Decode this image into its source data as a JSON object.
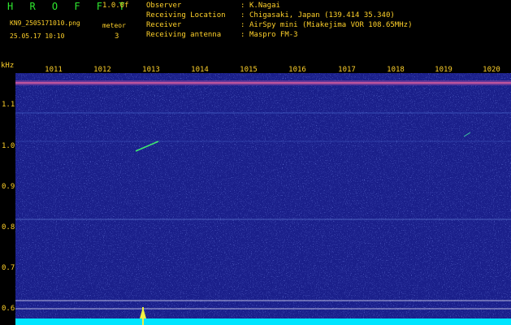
{
  "header": {
    "title": "H R O F F T",
    "version": "1.0.0f",
    "filename": "KN9_2505171010.png",
    "meteor_label": "meteor",
    "datetime": "25.05.17 10:10",
    "meteor_count": "3",
    "info": [
      {
        "label": "Observer",
        "value": "K.Nagai"
      },
      {
        "label": "Receiving Location",
        "value": "Chigasaki, Japan (139.414 35.340)"
      },
      {
        "label": "Receiver",
        "value": "AirSpy mini (Miakejima VOR 108.65MHz)"
      },
      {
        "label": "Receiving antenna",
        "value": "Maspro FM-3"
      }
    ],
    "separator": ":"
  },
  "axes": {
    "y_unit": "kHz",
    "x_ticks": [
      "1011",
      "1012",
      "1013",
      "1014",
      "1015",
      "1016",
      "1017",
      "1018",
      "1019",
      "1020"
    ],
    "y_ticks": [
      "1.1",
      "1.0",
      "0.9",
      "0.8",
      "0.7",
      "0.6"
    ]
  },
  "colors": {
    "label_yellow": "#ffd12a",
    "title_green": "#2fe82f",
    "background_blue": "#1a1f8a",
    "baseline_cyan": "#00e5ff"
  }
}
